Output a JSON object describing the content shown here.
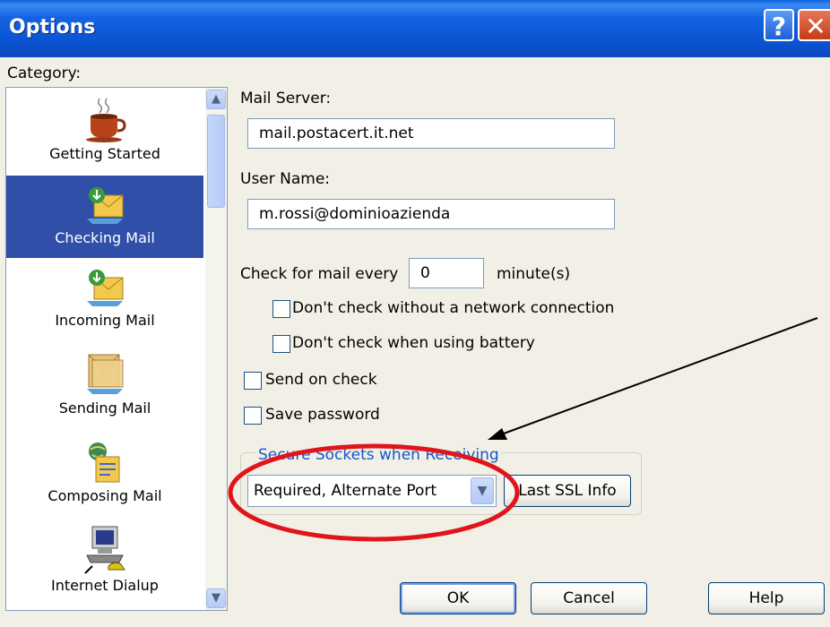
{
  "window": {
    "title": "Options",
    "help_glyph": "?",
    "close_glyph": "✕"
  },
  "category_label": "Category:",
  "categories": [
    {
      "label": "Getting Started",
      "icon": "coffee-cup-icon"
    },
    {
      "label": "Checking Mail",
      "icon": "check-mail-icon",
      "selected": true
    },
    {
      "label": "Incoming Mail",
      "icon": "incoming-mail-icon"
    },
    {
      "label": "Sending Mail",
      "icon": "sending-mail-icon"
    },
    {
      "label": "Composing Mail",
      "icon": "composing-mail-icon"
    },
    {
      "label": "Internet Dialup",
      "icon": "dialup-computer-icon"
    }
  ],
  "mail_server": {
    "label": "Mail Server:",
    "value": "mail.postacert.it.net"
  },
  "user_name": {
    "label": "User Name:",
    "value": "m.rossi@dominioazienda"
  },
  "check_every": {
    "label": "Check for mail every",
    "value": "0",
    "unit": "minute(s)"
  },
  "options": {
    "no_network": {
      "label": "Don't check without a network connection",
      "checked": false
    },
    "battery": {
      "label": "Don't check when using battery",
      "checked": false
    },
    "send_on_check": {
      "label": "Send on check",
      "checked": false
    },
    "save_password": {
      "label": "Save password",
      "checked": false
    }
  },
  "ssl": {
    "legend": "Secure Sockets when Receiving",
    "selected": "Required, Alternate Port",
    "info_button": "Last SSL Info"
  },
  "buttons": {
    "ok": "OK",
    "cancel": "Cancel",
    "help": "Help"
  },
  "annotation": {
    "color": "#e0141b"
  }
}
